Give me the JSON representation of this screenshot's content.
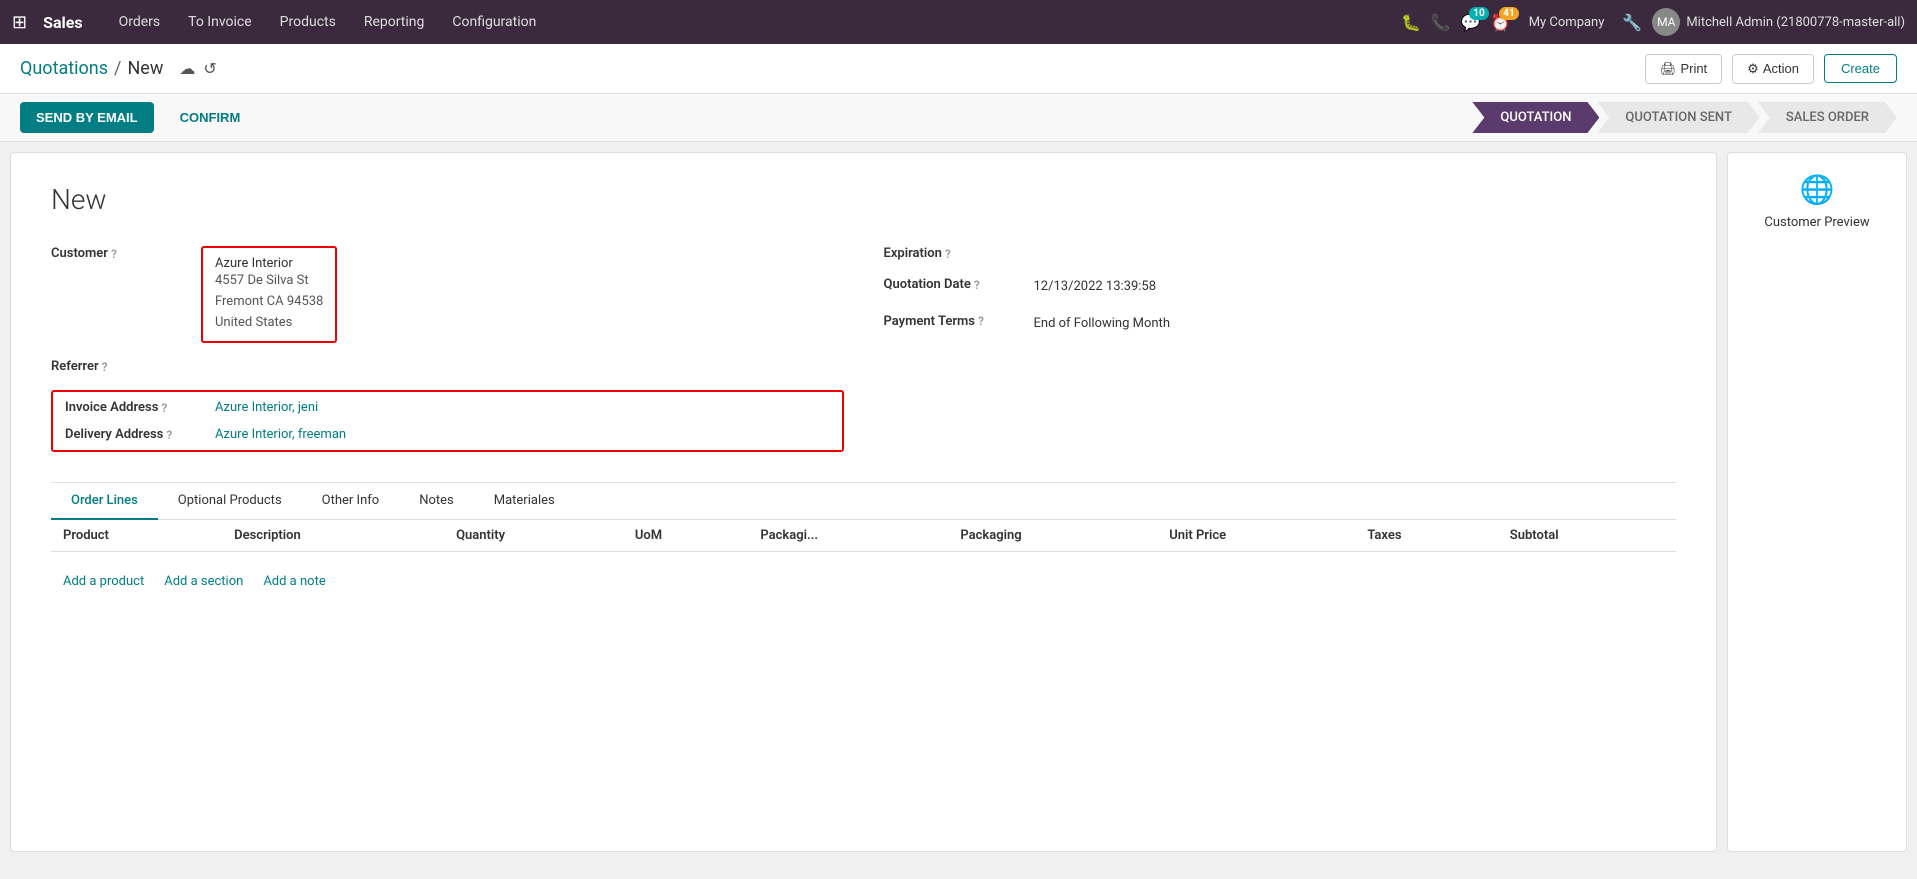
{
  "topnav": {
    "brand": "Sales",
    "items": [
      "Orders",
      "To Invoice",
      "Products",
      "Reporting",
      "Configuration"
    ],
    "chat_badge": "10",
    "clock_badge": "41",
    "company": "My Company",
    "user": "Mitchell Admin (21800778-master-all)"
  },
  "breadcrumb": {
    "parent": "Quotations",
    "separator": "/",
    "current": "New"
  },
  "toolbar": {
    "print_label": "Print",
    "action_label": "Action",
    "create_label": "Create"
  },
  "action_bar": {
    "send_email": "SEND BY EMAIL",
    "confirm": "CONFIRM"
  },
  "status_steps": [
    {
      "label": "QUOTATION",
      "active": true
    },
    {
      "label": "QUOTATION SENT",
      "active": false
    },
    {
      "label": "SALES ORDER",
      "active": false
    }
  ],
  "form": {
    "title": "New",
    "customer": {
      "label": "Customer",
      "name": "Azure Interior",
      "address_line1": "4557 De Silva St",
      "address_line2": "Fremont CA 94538",
      "address_line3": "United States"
    },
    "referrer": {
      "label": "Referrer"
    },
    "invoice_address": {
      "label": "Invoice Address",
      "value": "Azure Interior, jeni"
    },
    "delivery_address": {
      "label": "Delivery Address",
      "value": "Azure Interior, freeman"
    },
    "expiration": {
      "label": "Expiration",
      "value": ""
    },
    "quotation_date": {
      "label": "Quotation Date",
      "value": "12/13/2022 13:39:58"
    },
    "payment_terms": {
      "label": "Payment Terms",
      "value": "End of Following Month"
    }
  },
  "tabs": [
    {
      "label": "Order Lines",
      "active": true
    },
    {
      "label": "Optional Products",
      "active": false
    },
    {
      "label": "Other Info",
      "active": false
    },
    {
      "label": "Notes",
      "active": false
    },
    {
      "label": "Materiales",
      "active": false
    }
  ],
  "table": {
    "columns": [
      "Product",
      "Description",
      "Quantity",
      "UoM",
      "Packagi...",
      "Packaging",
      "Unit Price",
      "Taxes",
      "Subtotal"
    ],
    "add_product": "Add a product",
    "add_section": "Add a section",
    "add_note": "Add a note"
  },
  "sidebar": {
    "label": "Customer Preview"
  }
}
